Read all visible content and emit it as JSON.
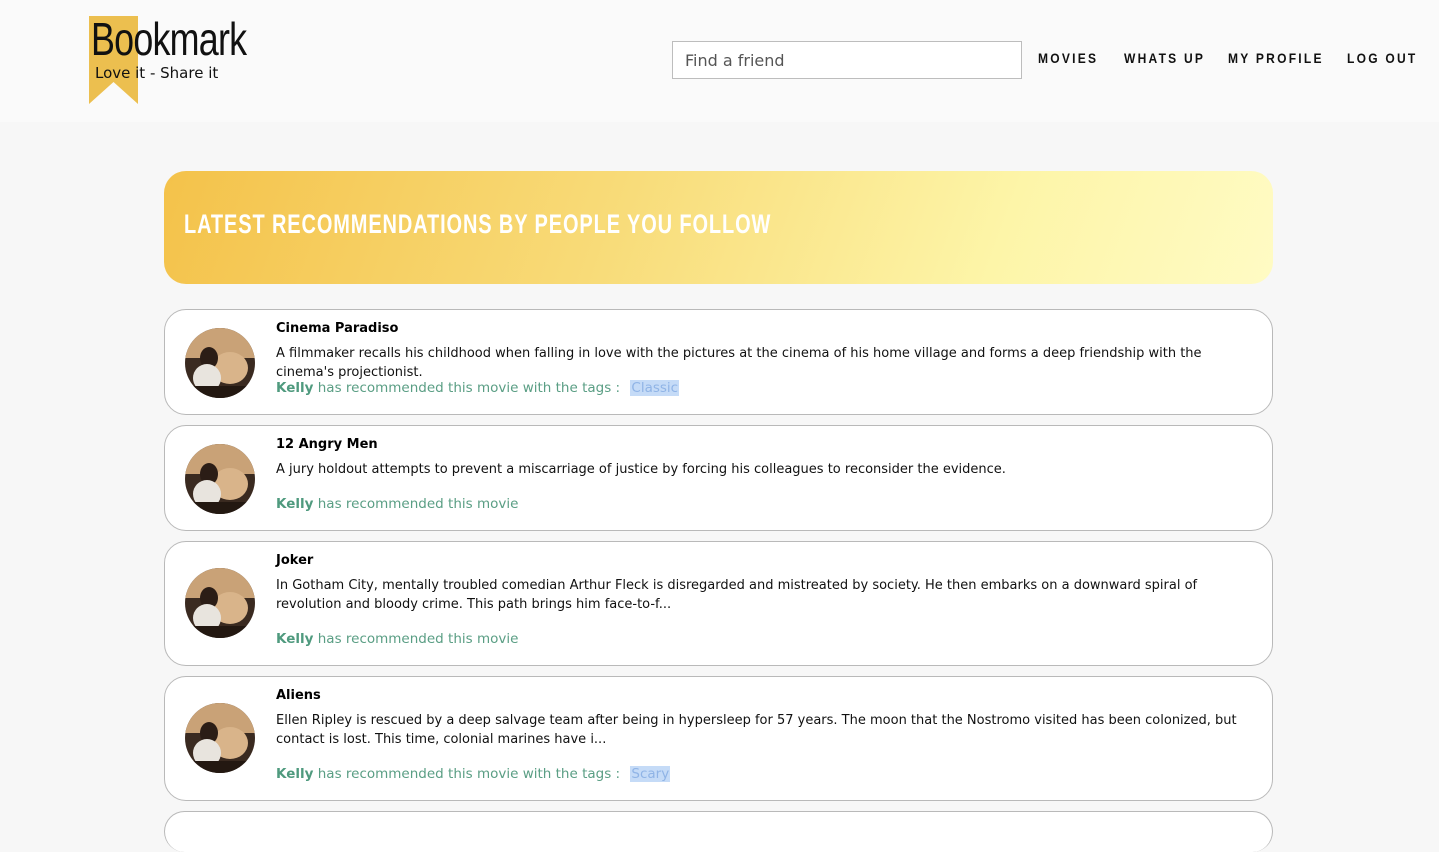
{
  "header": {
    "brand": "Bookmark",
    "tagline": "Love it - Share it",
    "search_placeholder": "Find a friend",
    "nav": [
      "MOVIES",
      "WHATS UP",
      "MY PROFILE",
      "LOG OUT"
    ]
  },
  "banner": {
    "title": "LATEST RECOMMENDATIONS BY PEOPLE YOU FOLLOW"
  },
  "colors": {
    "accent": "#f4c24a",
    "recommend_text": "#5a9e84",
    "tag_bg": "#c5dbf7"
  },
  "feed": [
    {
      "title": "Cinema Paradiso",
      "desc": "A filmmaker recalls his childhood when falling in love with the pictures at the cinema of his home village and forms a deep friendship with the cinema's projectionist.",
      "user": "Kelly",
      "rec_text": "has recommended this movie with the tags :",
      "tag": "Classic"
    },
    {
      "title": "12 Angry Men",
      "desc": "A jury holdout attempts to prevent a miscarriage of justice by forcing his colleagues to reconsider the evidence.",
      "user": "Kelly",
      "rec_text": "has recommended this movie",
      "tag": null
    },
    {
      "title": "Joker",
      "desc": "In Gotham City, mentally troubled comedian Arthur Fleck is disregarded and mistreated by society. He then embarks on a downward spiral of revolution and bloody crime. This path brings him face-to-f...",
      "user": "Kelly",
      "rec_text": "has recommended this movie",
      "tag": null
    },
    {
      "title": "Aliens",
      "desc": "Ellen Ripley is rescued by a deep salvage team after being in hypersleep for 57 years. The moon that the Nostromo visited has been colonized, but contact is lost. This time, colonial marines have i...",
      "user": "Kelly",
      "rec_text": "has recommended this movie with the tags :",
      "tag": "Scary"
    }
  ]
}
